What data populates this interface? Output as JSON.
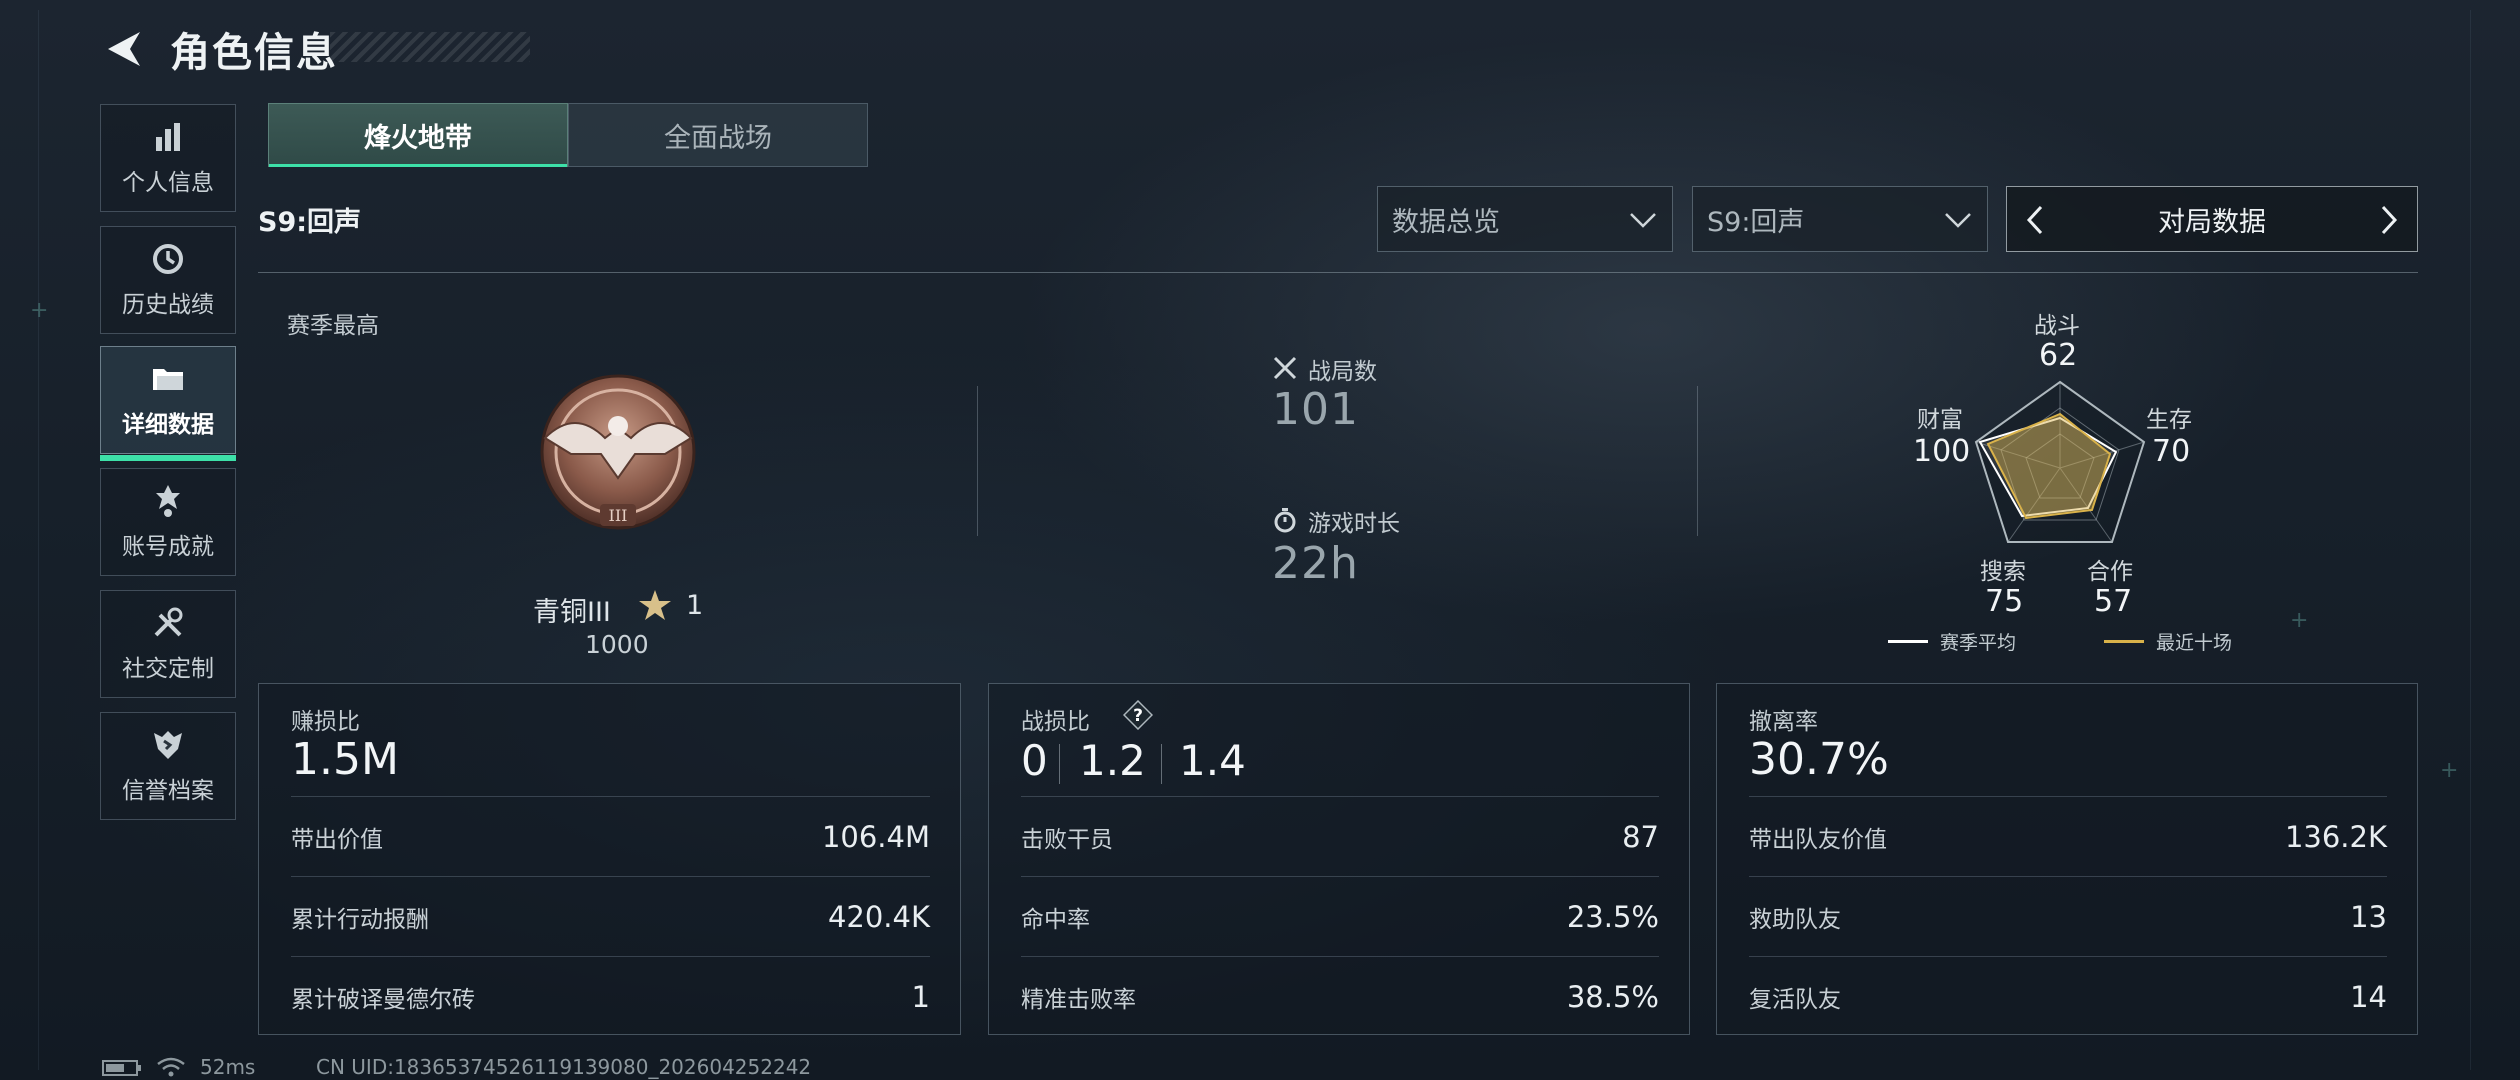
{
  "header": {
    "title": "角色信息"
  },
  "sidebar": {
    "items": [
      {
        "label": "个人信息",
        "icon": "bar-chart-icon",
        "active": false
      },
      {
        "label": "历史战绩",
        "icon": "history-clock-icon",
        "active": false
      },
      {
        "label": "详细数据",
        "icon": "folder-icon",
        "active": true
      },
      {
        "label": "账号成就",
        "icon": "achievement-medal-icon",
        "active": false
      },
      {
        "label": "社交定制",
        "icon": "tools-icon",
        "active": false
      },
      {
        "label": "信誉档案",
        "icon": "reputation-shield-icon",
        "active": false
      }
    ]
  },
  "mode_tabs": [
    {
      "label": "烽火地带",
      "active": true
    },
    {
      "label": "全面战场",
      "active": false
    }
  ],
  "season_label": "S9:回声",
  "filters": {
    "view": "数据总览",
    "season": "S9:回声",
    "category": "对局数据"
  },
  "season_best": {
    "label": "赛季最高",
    "rank_name": "青铜III",
    "stars": "1",
    "score": "1000"
  },
  "summary": {
    "matches_label": "战局数",
    "matches_value": "101",
    "playtime_label": "游戏时长",
    "playtime_value": "22h"
  },
  "radar": {
    "axes": [
      {
        "label": "战斗",
        "value": "62"
      },
      {
        "label": "生存",
        "value": "70"
      },
      {
        "label": "合作",
        "value": "57"
      },
      {
        "label": "搜索",
        "value": "75"
      },
      {
        "label": "财富",
        "value": "100"
      }
    ],
    "legend": [
      {
        "label": "赛季平均",
        "color": "#ffffff"
      },
      {
        "label": "最近十场",
        "color": "#d9b24a"
      }
    ]
  },
  "cards": {
    "profit": {
      "label": "赚损比",
      "value": "1.5M",
      "rows": [
        {
          "label": "带出价值",
          "value": "106.4M"
        },
        {
          "label": "累计行动报酬",
          "value": "420.4K"
        },
        {
          "label": "累计破译曼德尔砖",
          "value": "1"
        }
      ]
    },
    "kd": {
      "label": "战损比",
      "values": [
        "0",
        "1.2",
        "1.4"
      ],
      "rows": [
        {
          "label": "击败干员",
          "value": "87"
        },
        {
          "label": "命中率",
          "value": "23.5%"
        },
        {
          "label": "精准击败率",
          "value": "38.5%"
        }
      ]
    },
    "extract": {
      "label": "撤离率",
      "value": "30.7%",
      "rows": [
        {
          "label": "带出队友价值",
          "value": "136.2K"
        },
        {
          "label": "救助队友",
          "value": "13"
        },
        {
          "label": "复活队友",
          "value": "14"
        }
      ]
    }
  },
  "status_bar": {
    "ping": "52ms",
    "uid": "CN UID:18365374526119139080_202604252242"
  },
  "colors": {
    "accent": "#3de0a8",
    "radar_recent": "#d9b24a"
  }
}
